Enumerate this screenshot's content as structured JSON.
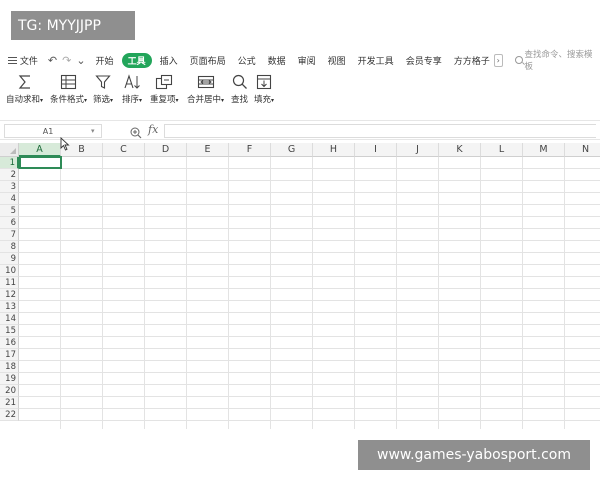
{
  "watermarks": {
    "top_left": "TG: MYYJJPP",
    "bottom_right": "www.games-yabosport.com"
  },
  "menubar": {
    "file_label": "文件",
    "undo_icon": "↶",
    "redo_icon": "↷",
    "dropdown_icon": "⌄",
    "tabs": [
      "开始",
      "工具",
      "插入",
      "页面布局",
      "公式",
      "数据",
      "审阅",
      "视图",
      "开发工具",
      "会员专享",
      "方方格子"
    ],
    "active_tab": "工具",
    "more_icon": "›",
    "search_placeholder": "查找命令、搜索模板"
  },
  "toolbar": {
    "items": [
      {
        "label": "自动求和",
        "icon": "sum-icon",
        "has_dropdown": true
      },
      {
        "label": "条件格式",
        "icon": "conditional-format-icon",
        "has_dropdown": true
      },
      {
        "label": "筛选",
        "icon": "filter-icon",
        "has_dropdown": true
      },
      {
        "label": "排序",
        "icon": "sort-icon",
        "has_dropdown": true
      },
      {
        "label": "重复项",
        "icon": "duplicates-icon",
        "has_dropdown": true
      },
      {
        "label": "合并居中",
        "icon": "merge-center-icon",
        "has_dropdown": true
      },
      {
        "label": "查找",
        "icon": "find-icon",
        "has_dropdown": false
      },
      {
        "label": "填充",
        "icon": "fill-icon",
        "has_dropdown": true
      }
    ]
  },
  "formula_bar": {
    "name_box": "A1",
    "name_box_caret": "▾",
    "fx_label": "fx",
    "formula": ""
  },
  "sheet": {
    "columns": [
      "A",
      "B",
      "C",
      "D",
      "E",
      "F",
      "G",
      "H",
      "I",
      "J",
      "K",
      "L",
      "M",
      "N"
    ],
    "rows": [
      "1",
      "2",
      "3",
      "4",
      "5",
      "6",
      "7",
      "8",
      "9",
      "10",
      "11",
      "12",
      "13",
      "14",
      "15",
      "16",
      "17",
      "18",
      "19",
      "20",
      "21",
      "22"
    ],
    "selected_cell": "A1",
    "accent_color": "#2e8b57"
  }
}
